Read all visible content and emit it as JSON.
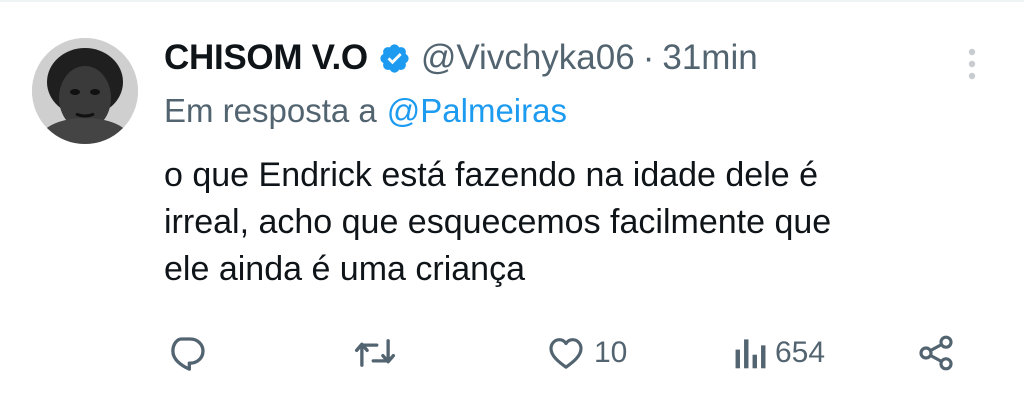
{
  "tweet": {
    "display_name": "CHISOM V.O",
    "handle": "@Vivchyka06",
    "separator": "·",
    "time": "31min",
    "reply_prefix": "Em resposta a",
    "reply_to": "@Palmeiras",
    "text_lines": [
      "o que Endrick está fazendo na idade dele é",
      "irreal, acho que esquecemos facilmente que",
      "ele ainda é uma criança"
    ],
    "likes": "10",
    "views": "654"
  },
  "colors": {
    "text_primary": "#0f1419",
    "text_secondary": "#536471",
    "accent": "#1d9bf0"
  },
  "icons": {
    "verified": "verified-badge-icon",
    "more": "more-vertical-icon",
    "reply": "reply-icon",
    "retweet": "retweet-icon",
    "like": "heart-icon",
    "views": "views-icon",
    "share": "share-icon"
  }
}
